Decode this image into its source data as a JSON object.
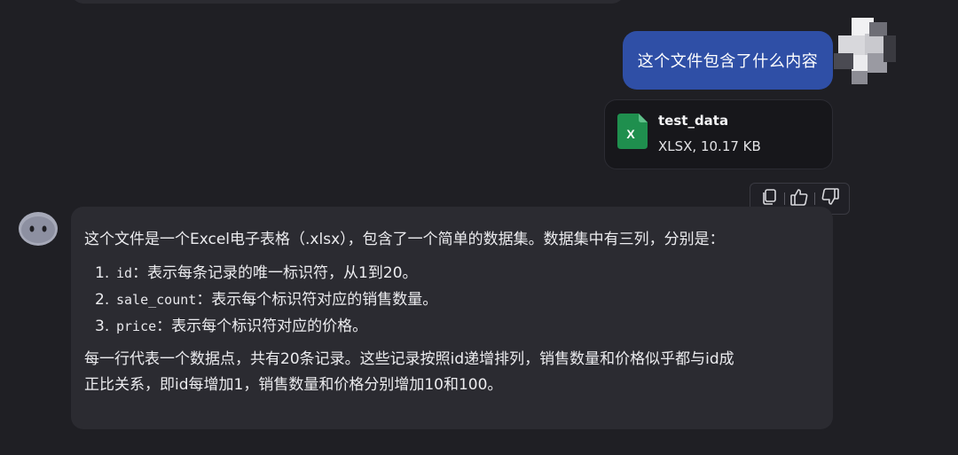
{
  "colors": {
    "background": "#1f1f24",
    "user_bubble": "#2f4fa6",
    "bot_bubble": "#2b2b31",
    "file_card": "#17171b",
    "excel_green": "#1f8f4e"
  },
  "user_message": {
    "text": "这个文件包含了什么内容"
  },
  "attachment": {
    "icon": "excel-file-icon",
    "name": "test_data",
    "meta": "XLSX, 10.17 KB"
  },
  "actions": [
    {
      "name": "copy",
      "icon": "copy-icon"
    },
    {
      "name": "like",
      "icon": "thumbs-up-icon"
    },
    {
      "name": "dislike",
      "icon": "thumbs-down-icon"
    }
  ],
  "assistant_message": {
    "intro": "这个文件是一个Excel电子表格（.xlsx），包含了一个简单的数据集。数据集中有三列，分别是：",
    "columns": [
      {
        "num": "1.",
        "code": "id",
        "desc": "：表示每条记录的唯一标识符，从1到20。"
      },
      {
        "num": "2.",
        "code": "sale_count",
        "desc": "：表示每个标识符对应的销售数量。"
      },
      {
        "num": "3.",
        "code": "price",
        "desc": "：表示每个标识符对应的价格。"
      }
    ],
    "summary_line1": "每一行代表一个数据点，共有20条记录。这些记录按照id递增排列，销售数量和价格似乎都与id成",
    "summary_line2": "正比关系，即id每增加1，销售数量和价格分别增加10和100。"
  }
}
